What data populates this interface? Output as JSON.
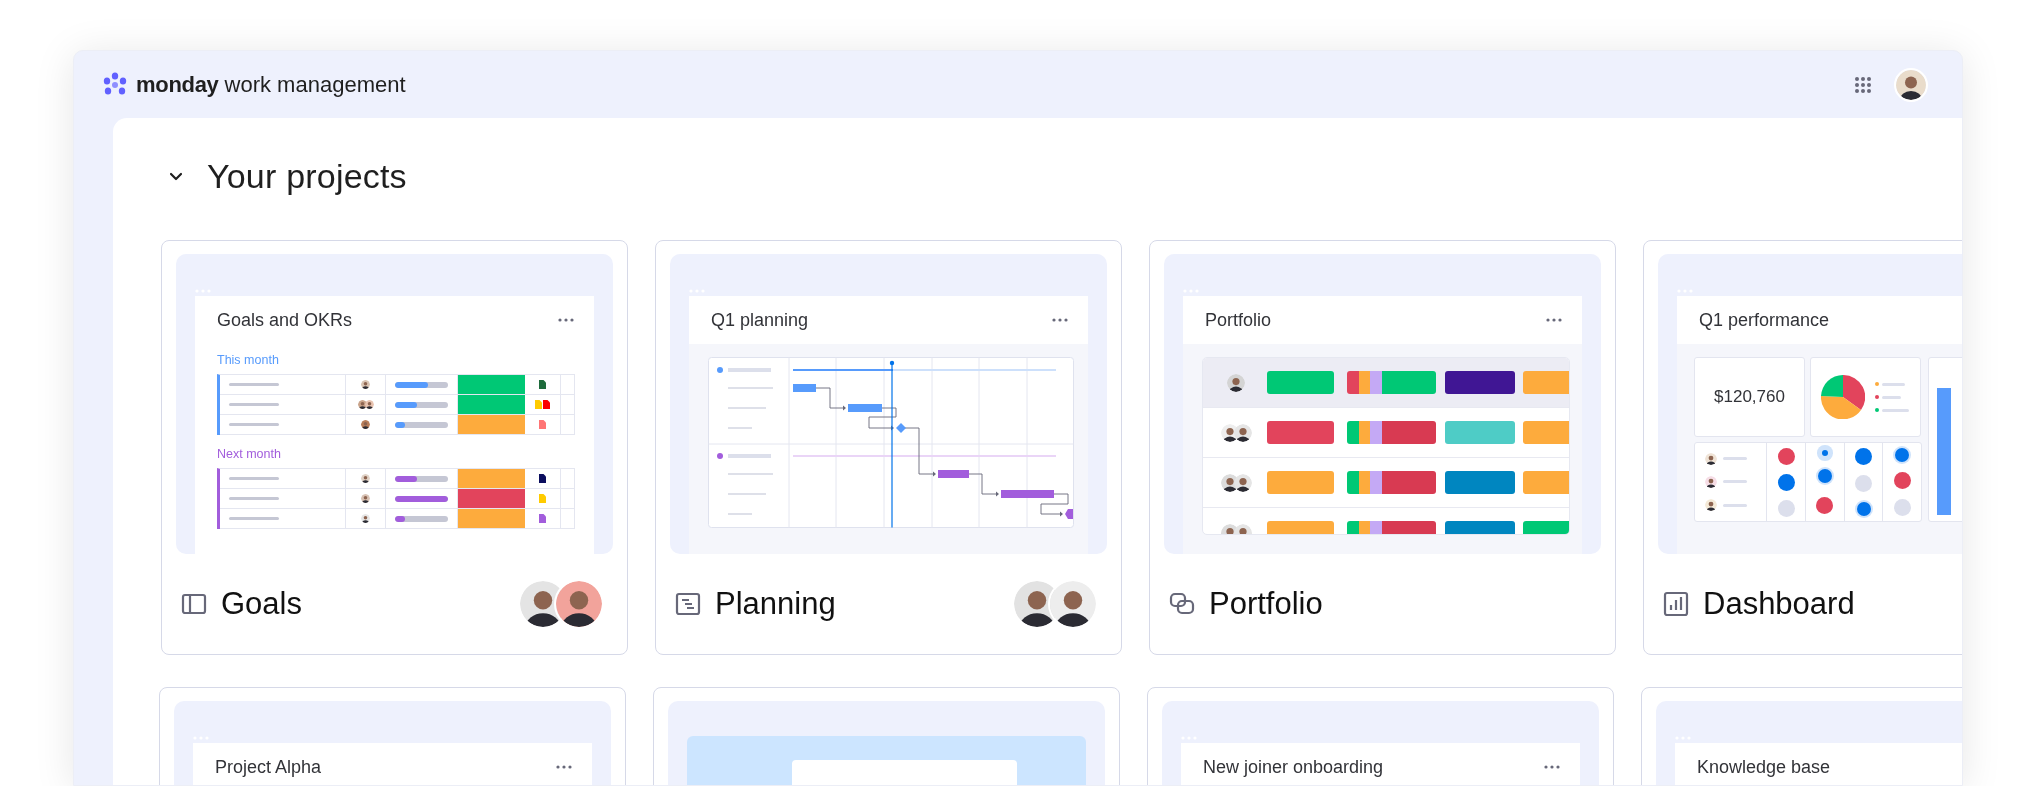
{
  "header": {
    "brand": "monday",
    "product": "work management",
    "user": {
      "color": "#e9dccb"
    }
  },
  "section": {
    "title": "Your projects",
    "expanded": true
  },
  "projects": [
    {
      "kind": "board",
      "name": "Goals",
      "members": [
        {
          "color": "#e4e4e4"
        },
        {
          "color": "#f2a39b"
        }
      ],
      "preview": {
        "title": "Goals and OKRs",
        "groups": [
          {
            "label": "This month",
            "color": "#579bfc",
            "rows": [
              {
                "people": [
                  {
                    "color": "#d9c4b3"
                  }
                ],
                "level": 0.63,
                "color": "#00c875",
                "files": [
                  {
                    "color": "#1e6b3c"
                  }
                ]
              },
              {
                "people": [
                  {
                    "color": "#c9a38a"
                  },
                  {
                    "color": "#e8c3b0"
                  }
                ],
                "level": 0.41,
                "color": "#00c875",
                "files": [
                  {
                    "color": "#ffcb00"
                  },
                  {
                    "color": "#fb0000"
                  }
                ]
              },
              {
                "people": [
                  {
                    "color": "#b97e5a"
                  }
                ],
                "level": 0.19,
                "color": "#fdab3d",
                "files": [
                  {
                    "color": "#ff7575"
                  }
                ]
              }
            ]
          },
          {
            "label": "Next month",
            "color": "#a25ddc",
            "rows": [
              {
                "people": [
                  {
                    "color": "#e0d2c6"
                  }
                ],
                "level": 0.41,
                "color": "#fdab3d",
                "files": [
                  {
                    "color": "#0b0e5e"
                  }
                ]
              },
              {
                "people": [
                  {
                    "color": "#d8c2b4"
                  }
                ],
                "level": 1,
                "color": "#e2445c",
                "files": [
                  {
                    "color": "#ffcb00"
                  }
                ]
              },
              {
                "people": [
                  {
                    "color": "#e6e6e6"
                  }
                ],
                "level": 0.19,
                "color": "#fdab3d",
                "files": [
                  {
                    "color": "#a25ddc"
                  }
                ]
              }
            ]
          }
        ]
      }
    },
    {
      "kind": "timeline",
      "name": "Planning",
      "members": [
        {
          "color": "#e2e2e2"
        },
        {
          "color": "#ededed"
        }
      ],
      "preview": {
        "title": "Q1 planning"
      }
    },
    {
      "kind": "portfolio",
      "name": "Portfolio",
      "preview": {
        "title": "Portfolio",
        "rows": [
          {
            "selected": true,
            "people": [
              {
                "color": "#d4d4d4"
              }
            ],
            "cells": [
              [
                {
                  "color": "#00c875"
                }
              ],
              [
                {
                  "color": "#e2445c"
                },
                {
                  "color": "#fdab3d"
                },
                {
                  "color": "#c4a9f5"
                },
                {
                  "color": "#00c875"
                }
              ],
              [
                {
                  "color": "#401694"
                }
              ],
              [
                {
                  "color": "#fdab3d"
                }
              ]
            ]
          },
          {
            "selected": false,
            "people": [
              {
                "color": "#eeeeee"
              },
              {
                "color": "#e5e5e5"
              }
            ],
            "cells": [
              [
                {
                  "color": "#e2445c"
                }
              ],
              [
                {
                  "color": "#00c875"
                },
                {
                  "color": "#fdab3d"
                },
                {
                  "color": "#c4a9f5"
                },
                {
                  "color": "#d83a52"
                }
              ],
              [
                {
                  "color": "#4eccc6"
                }
              ],
              [
                {
                  "color": "#fdab3d"
                }
              ]
            ]
          },
          {
            "selected": false,
            "people": [
              {
                "color": "#dcdcdc"
              },
              {
                "color": "#e5e5e5"
              }
            ],
            "cells": [
              [
                {
                  "color": "#fdab3d"
                }
              ],
              [
                {
                  "color": "#00c875"
                },
                {
                  "color": "#fdab3d"
                },
                {
                  "color": "#c4a9f5"
                },
                {
                  "color": "#d83a52"
                }
              ],
              [
                {
                  "color": "#0086c0"
                }
              ],
              [
                {
                  "color": "#fdab3d"
                }
              ]
            ]
          },
          {
            "selected": false,
            "people": [
              {
                "color": "#dcdcdc"
              },
              {
                "color": "#e5e5e5"
              }
            ],
            "cells": [
              [
                {
                  "color": "#fdab3d"
                }
              ],
              [
                {
                  "color": "#00c875"
                },
                {
                  "color": "#fdab3d"
                },
                {
                  "color": "#c4a9f5"
                },
                {
                  "color": "#d83a52"
                }
              ],
              [
                {
                  "color": "#0086c0"
                }
              ],
              [
                {
                  "color": "#00c875"
                }
              ]
            ]
          }
        ]
      }
    },
    {
      "kind": "dashboard",
      "name": "Dashboard",
      "preview": {
        "title": "Q1 performance",
        "figure": "$120,760",
        "legend": [
          {
            "color": "#fdab3d"
          },
          {
            "color": "#e2445c"
          },
          {
            "color": "#00c875"
          }
        ],
        "people": [
          {
            "color": "#efe3d6"
          },
          {
            "color": "#f6dde6"
          },
          {
            "color": "#f4ead8"
          }
        ],
        "dots": [
          [
            {
              "kind": "solid",
              "color": "#e2445c"
            },
            {
              "kind": "small",
              "color": "#0073ea"
            },
            {
              "kind": "solid",
              "color": "#0073ea"
            },
            {
              "kind": "ring",
              "color": "#0073ea"
            }
          ],
          [
            {
              "kind": "solid",
              "color": "#0073ea"
            },
            {
              "kind": "ring",
              "color": "#0073ea"
            },
            {
              "kind": "solid",
              "color": "#dcdfec"
            },
            {
              "kind": "solid",
              "color": "#e2445c"
            }
          ],
          [
            {
              "kind": "solid",
              "color": "#dcdfec"
            },
            {
              "kind": "solid",
              "color": "#e2445c"
            },
            {
              "kind": "ring",
              "color": "#0073ea"
            },
            {
              "kind": "solid",
              "color": "#dcdfec"
            }
          ]
        ]
      }
    }
  ],
  "more_projects": [
    {
      "kind": "window",
      "title": "Project Alpha"
    },
    {
      "kind": "picture"
    },
    {
      "kind": "window",
      "title": "New joiner onboarding"
    },
    {
      "kind": "window",
      "title": "Knowledge base"
    }
  ]
}
